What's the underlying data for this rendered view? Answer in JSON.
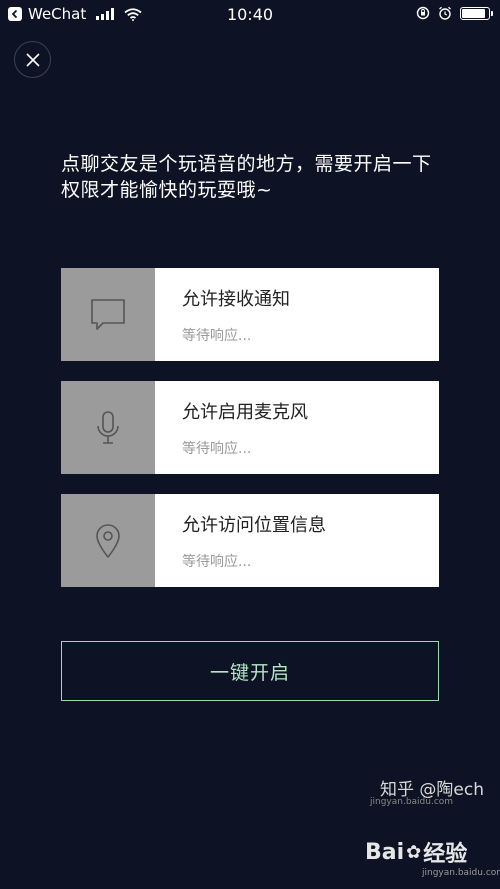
{
  "status_bar": {
    "carrier": "WeChat",
    "time": "10:40",
    "battery_level": 0.9
  },
  "close_button": {
    "icon": "close-icon"
  },
  "intro_text": "点聊交友是个玩语音的地方，需要开启一下权限才能愉快的玩耍哦~",
  "permissions": [
    {
      "icon": "chat-bubble-icon",
      "title": "允许接收通知",
      "status": "等待响应..."
    },
    {
      "icon": "microphone-icon",
      "title": "允许启用麦克风",
      "status": "等待响应..."
    },
    {
      "icon": "location-pin-icon",
      "title": "允许访问位置信息",
      "status": "等待响应..."
    }
  ],
  "enable_button": {
    "label": "一键开启"
  },
  "watermarks": {
    "zhihu": "知乎 @陶ech",
    "url": "jingyan.baidu.com",
    "baidu": "Bai",
    "baidu_suffix": "经验",
    "baidu_sub": "jingyan.baidu.com"
  },
  "colors": {
    "background": "#0d1324",
    "accent_border": "#9fd6b4",
    "icon_box": "#9b9b9b"
  }
}
